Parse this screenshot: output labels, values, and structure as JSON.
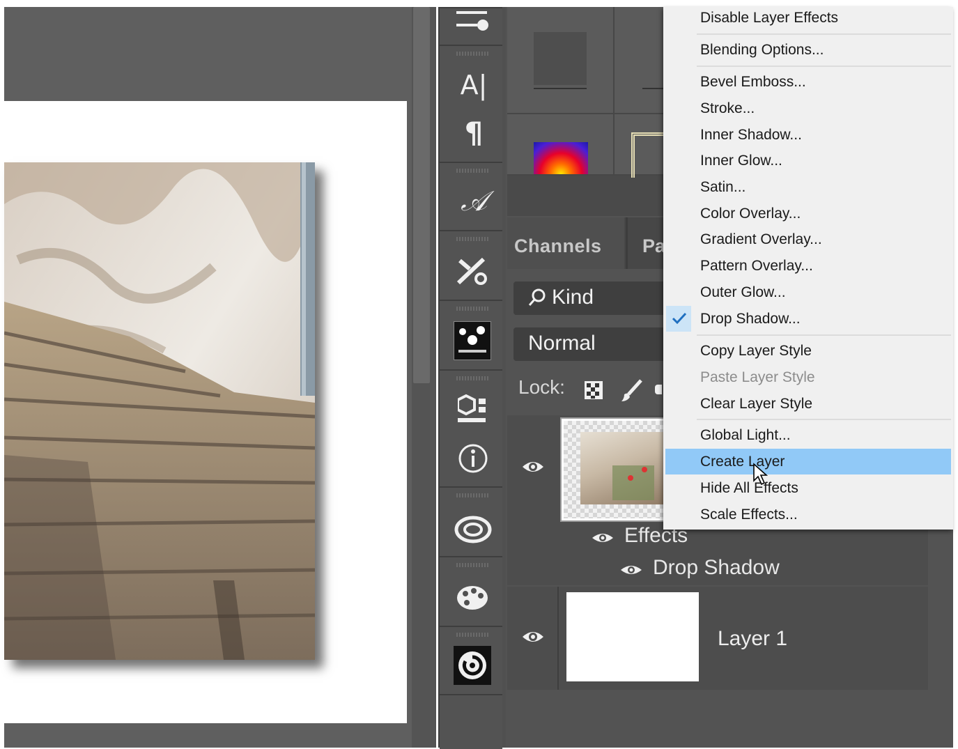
{
  "panel": {
    "tabs": [
      "Channels",
      "Pa"
    ],
    "filter_label": "Kind",
    "blend_mode": "Normal",
    "lock_label": "Lock:"
  },
  "layers": {
    "effects_label": "Effects",
    "drop_shadow_label": "Drop Shadow",
    "layer1_name": "Layer 1"
  },
  "tools": {
    "character_glyph": "A|",
    "paragraph_glyph": "¶",
    "glyphs_glyph": "𝒜"
  },
  "context_menu": {
    "items": [
      {
        "label": "Disable Layer Effects",
        "state": "normal"
      },
      {
        "label": "Blending Options...",
        "state": "normal"
      },
      {
        "label": "Bevel  Emboss...",
        "state": "normal"
      },
      {
        "label": "Stroke...",
        "state": "normal"
      },
      {
        "label": "Inner Shadow...",
        "state": "normal"
      },
      {
        "label": "Inner Glow...",
        "state": "normal"
      },
      {
        "label": "Satin...",
        "state": "normal"
      },
      {
        "label": "Color Overlay...",
        "state": "normal"
      },
      {
        "label": "Gradient Overlay...",
        "state": "normal"
      },
      {
        "label": "Pattern Overlay...",
        "state": "normal"
      },
      {
        "label": "Outer Glow...",
        "state": "normal"
      },
      {
        "label": "Drop Shadow...",
        "state": "checked"
      },
      {
        "label": "Copy Layer Style",
        "state": "normal"
      },
      {
        "label": "Paste Layer Style",
        "state": "disabled"
      },
      {
        "label": "Clear Layer Style",
        "state": "normal"
      },
      {
        "label": "Global Light...",
        "state": "normal"
      },
      {
        "label": "Create Layer",
        "state": "highlighted"
      },
      {
        "label": "Hide All Effects",
        "state": "normal"
      },
      {
        "label": "Scale Effects...",
        "state": "normal"
      }
    ],
    "highlight_color": "#91c9f7",
    "check_color": "#1f6fc0"
  },
  "colors": {
    "canvas_bg": "#5f5f5f",
    "panel_bg": "#535353",
    "menu_bg": "#f0f0f0"
  }
}
